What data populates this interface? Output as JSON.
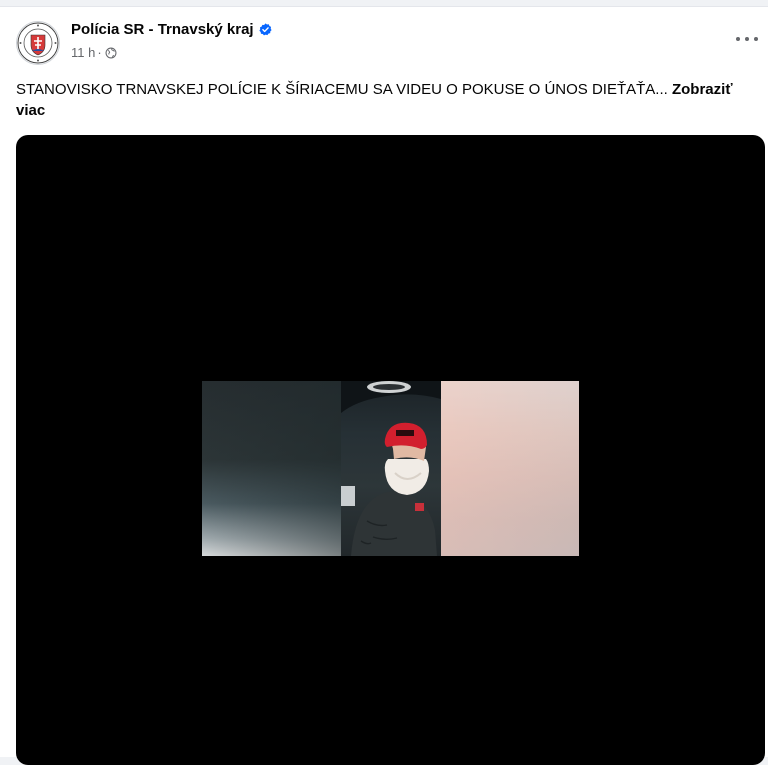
{
  "post": {
    "page_name": "Polícia SR - Trnavský kraj",
    "time": "11 h",
    "separator": "·",
    "audience_icon": "globe-icon",
    "verified_icon": "verified-badge-icon",
    "more_icon": "more-options-icon",
    "text": "STANOVISKO TRNAVSKEJ POLÍCIE K ŠÍRIACEMU SA VIDEU O POKUSE O ÚNOS DIEŤAŤA...",
    "see_more": "Zobraziť viac"
  },
  "colors": {
    "background": "#f0f2f5",
    "card": "#ffffff",
    "primary_text": "#050505",
    "secondary_text": "#65676b",
    "verified_blue": "#0866ff",
    "video_bg": "#000000"
  }
}
